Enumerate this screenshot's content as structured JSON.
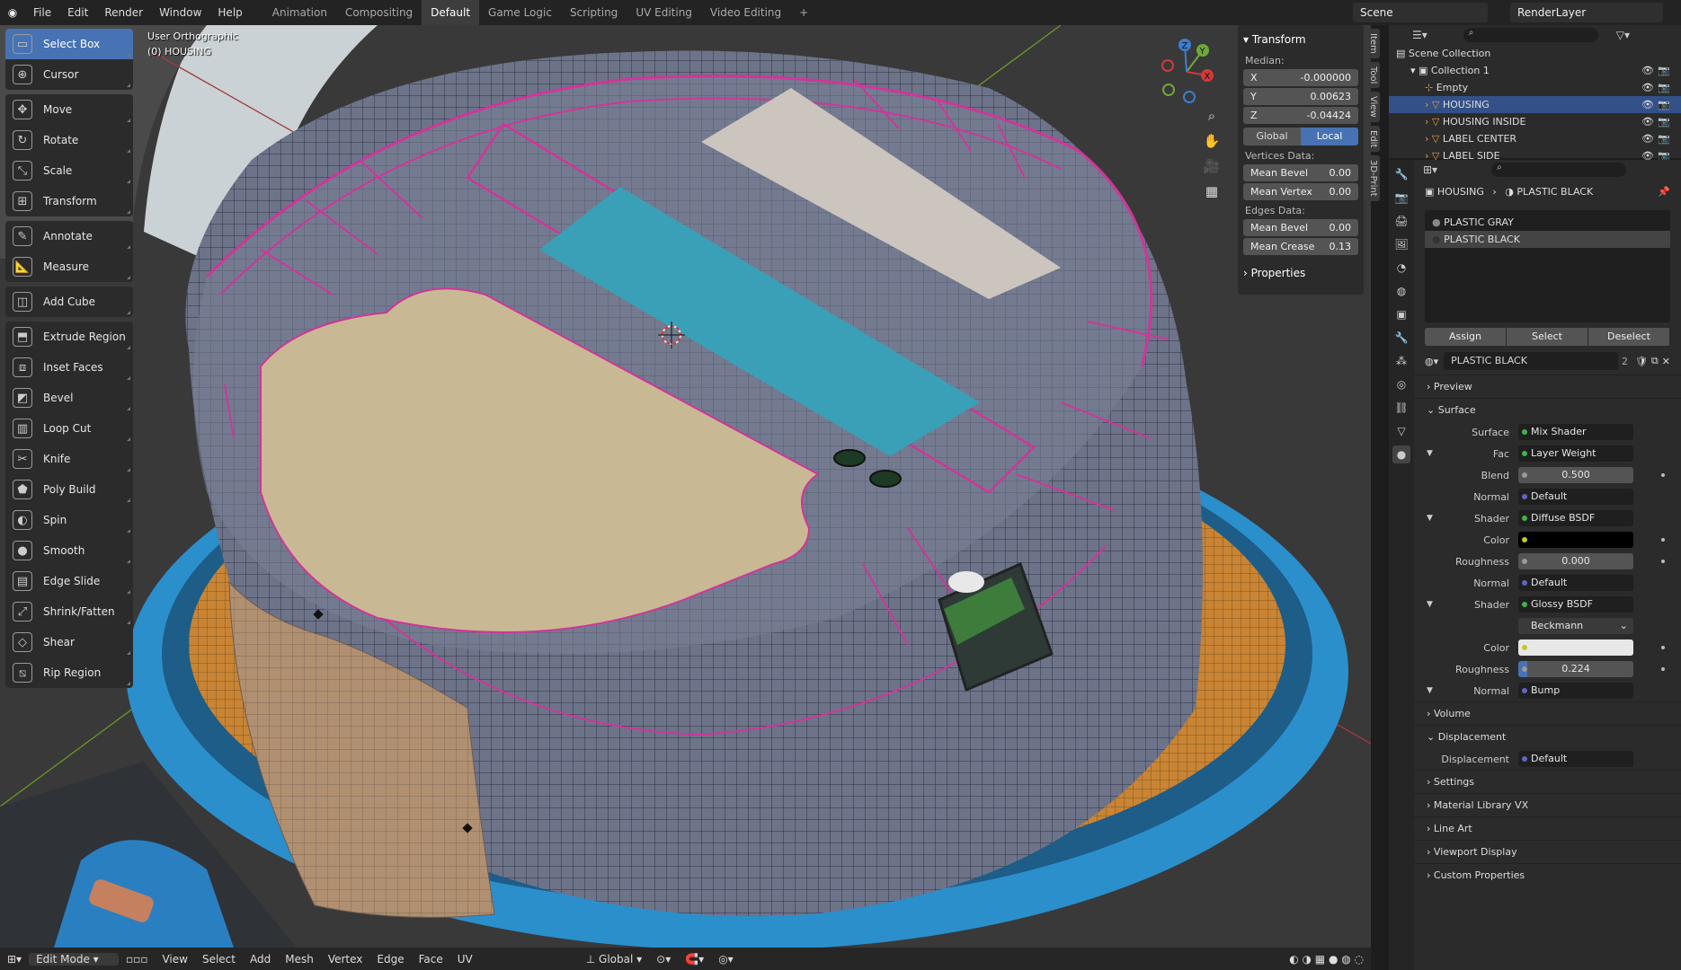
{
  "topbar": {
    "menus": [
      "File",
      "Edit",
      "Render",
      "Window",
      "Help"
    ],
    "workspaces": [
      "Animation",
      "Compositing",
      "Default",
      "Game Logic",
      "Scripting",
      "UV Editing",
      "Video Editing"
    ],
    "active_workspace": "Default",
    "add_tab": "+",
    "scene": "Scene",
    "view_layer": "RenderLayer"
  },
  "toolbar": {
    "groups": [
      [
        "Select Box",
        "Cursor"
      ],
      [
        "Move",
        "Rotate",
        "Scale",
        "Transform"
      ],
      [
        "Annotate",
        "Measure"
      ],
      [
        "Add Cube"
      ],
      [
        "Extrude Region",
        "Inset Faces",
        "Bevel",
        "Loop Cut",
        "Knife",
        "Poly Build",
        "Spin",
        "Smooth",
        "Edge Slide",
        "Shrink/Fatten",
        "Shear",
        "Rip Region"
      ]
    ],
    "icons": {
      "Select Box": "▭",
      "Cursor": "⊕",
      "Move": "✥",
      "Rotate": "↻",
      "Scale": "⤡",
      "Transform": "⊞",
      "Annotate": "✎",
      "Measure": "📐",
      "Add Cube": "◫",
      "Extrude Region": "⬒",
      "Inset Faces": "⧈",
      "Bevel": "◩",
      "Loop Cut": "▥",
      "Knife": "✂",
      "Poly Build": "⬟",
      "Spin": "◐",
      "Smooth": "●",
      "Edge Slide": "▤",
      "Shrink/Fatten": "⤢",
      "Shear": "◇",
      "Rip Region": "⧅"
    },
    "active": "Select Box"
  },
  "viewport": {
    "view_name": "User Orthographic",
    "object_label": "(0) HOUSING",
    "gizmo_axes": [
      "X",
      "Y",
      "Z"
    ]
  },
  "npanel": {
    "header": "Transform",
    "median_label": "Median:",
    "median": [
      {
        "axis": "X",
        "value": "-0.000000"
      },
      {
        "axis": "Y",
        "value": "0.00623"
      },
      {
        "axis": "Z",
        "value": "-0.04424"
      }
    ],
    "space_options": [
      "Global",
      "Local"
    ],
    "space_active": "Local",
    "vertices_label": "Vertices Data:",
    "vertices": [
      {
        "name": "Mean Bevel",
        "value": "0.00"
      },
      {
        "name": "Mean Vertex",
        "value": "0.00"
      }
    ],
    "edges_label": "Edges Data:",
    "edges": [
      {
        "name": "Mean Bevel",
        "value": "0.00"
      },
      {
        "name": "Mean Crease",
        "value": "0.13"
      }
    ],
    "properties_label": "Properties",
    "side_tabs": [
      "Item",
      "Tool",
      "View",
      "Edit",
      "3D-Print"
    ]
  },
  "bottombar": {
    "mode": "Edit Mode",
    "menus": [
      "View",
      "Select",
      "Add",
      "Mesh",
      "Vertex",
      "Edge",
      "Face",
      "UV"
    ],
    "orientation": "Global"
  },
  "outliner": {
    "rows": [
      {
        "label": "Scene Collection",
        "indent": 0,
        "selected": false
      },
      {
        "label": "Collection 1",
        "indent": 1,
        "selected": false
      },
      {
        "label": "Empty",
        "indent": 2,
        "selected": false
      },
      {
        "label": "HOUSING",
        "indent": 2,
        "selected": true
      },
      {
        "label": "HOUSING INSIDE",
        "indent": 2,
        "selected": false
      },
      {
        "label": "LABEL CENTER",
        "indent": 2,
        "selected": false
      },
      {
        "label": "LABEL SIDE",
        "indent": 2,
        "selected": false
      }
    ]
  },
  "properties": {
    "breadcrumb_object": "HOUSING",
    "breadcrumb_sep": "›",
    "breadcrumb_material": "PLASTIC BLACK",
    "slots": [
      "PLASTIC GRAY",
      "PLASTIC BLACK"
    ],
    "active_slot": "PLASTIC BLACK",
    "slot_buttons": [
      "Assign",
      "Select",
      "Deselect"
    ],
    "material_name": "PLASTIC BLACK",
    "user_count": "2",
    "sections": {
      "preview": "Preview",
      "surface": "Surface",
      "volume": "Volume",
      "displacement": "Displacement",
      "settings": "Settings",
      "material_library": "Material Library VX",
      "line_art": "Line Art",
      "viewport_display": "Viewport Display",
      "custom_properties": "Custom Properties"
    },
    "surface_rows": [
      {
        "label": "Surface",
        "value": "Mix Shader",
        "kind": "socket",
        "dot": "#3fb54a"
      },
      {
        "label": "Fac",
        "value": "Layer Weight",
        "kind": "socket",
        "dot": "#3fb54a",
        "tri": true
      },
      {
        "label": "Blend",
        "value": "0.500",
        "kind": "num",
        "dot": "#9a9a9a"
      },
      {
        "label": "Normal",
        "value": "Default",
        "kind": "socket",
        "dot": "#6363c7"
      },
      {
        "label": "Shader",
        "value": "Diffuse BSDF",
        "kind": "socket",
        "dot": "#3fb54a",
        "tri": true
      },
      {
        "label": "Color",
        "value": "",
        "kind": "color",
        "dot": "#c7c729",
        "swatch": "#000000"
      },
      {
        "label": "Roughness",
        "value": "0.000",
        "kind": "num",
        "dot": "#9a9a9a"
      },
      {
        "label": "Normal",
        "value": "Default",
        "kind": "socket",
        "dot": "#6363c7"
      },
      {
        "label": "Shader",
        "value": "Glossy BSDF",
        "kind": "socket",
        "dot": "#3fb54a",
        "tri": true
      },
      {
        "label": "",
        "value": "Beckmann",
        "kind": "dropdown"
      },
      {
        "label": "Color",
        "value": "",
        "kind": "color",
        "dot": "#c7c729",
        "swatch": "#e8e8e8"
      },
      {
        "label": "Roughness",
        "value": "0.224",
        "kind": "slider",
        "dot": "#9a9a9a",
        "fill": 0.08
      },
      {
        "label": "Normal",
        "value": "Bump",
        "kind": "socket",
        "dot": "#6363c7",
        "tri": true
      }
    ],
    "displacement_row": {
      "label": "Displacement",
      "value": "Default",
      "dot": "#6363c7"
    }
  },
  "colors": {
    "accent": "#4772b3",
    "selection_edge": "#d0359a",
    "housing_body": "#6d7489",
    "label_sand": "#c9b894",
    "label_blue": "#3aa0b8",
    "ring_blue": "#2b8fcc",
    "orange_faces": "#d28a3a"
  }
}
